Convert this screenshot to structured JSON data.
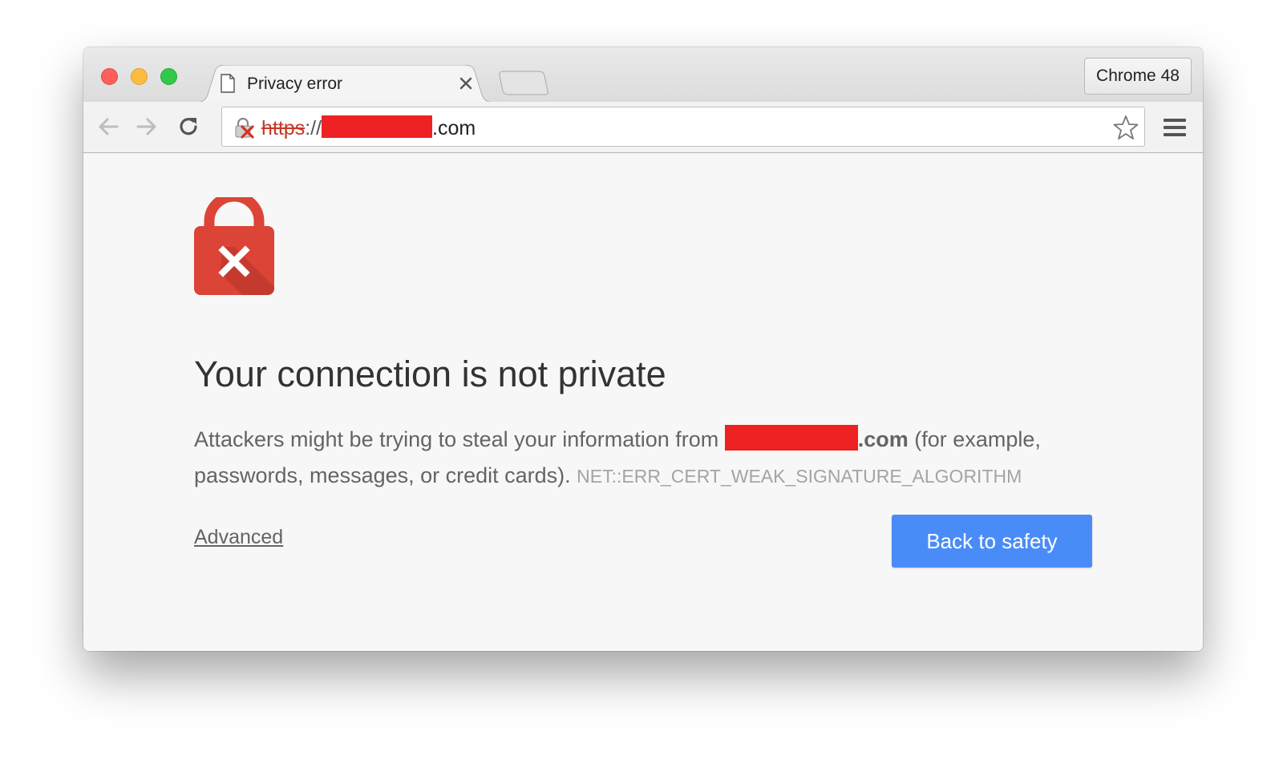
{
  "browser": {
    "tab": {
      "title": "Privacy error",
      "icon": "page-icon",
      "close_icon": "close-icon"
    },
    "profile_label": "Chrome 48",
    "address": {
      "scheme": "https",
      "separator": "://",
      "domain_suffix": ".com",
      "security_icon": "not-secure-lock-icon"
    }
  },
  "page": {
    "heading": "Your connection is not private",
    "body_prefix": "Attackers might be trying to steal your information from ",
    "body_domain_suffix": ".com",
    "body_suffix": " (for example, passwords, messages, or credit cards). ",
    "error_code": "NET::ERR_CERT_WEAK_SIGNATURE_ALGORITHM",
    "advanced_link": "Advanced",
    "primary_button": "Back to safety"
  },
  "colors": {
    "accent_button": "#4a8cf7",
    "error_red": "#db4437",
    "redaction": "#ee2123"
  }
}
